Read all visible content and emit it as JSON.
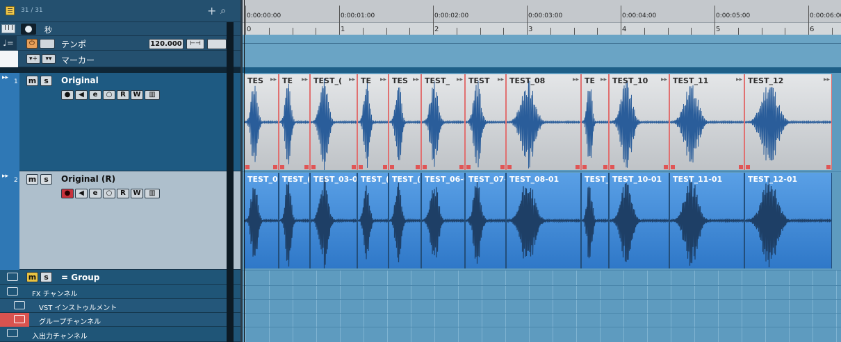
{
  "header": {
    "track_count": "31 / 31",
    "add": "+",
    "search": "⌕"
  },
  "ruler_tracks": {
    "time_unit": "秒",
    "tempo": {
      "label": "テンポ",
      "value": "120.000"
    },
    "marker": {
      "label": "マーカー"
    }
  },
  "tracks": [
    {
      "number": "1",
      "name": "Original",
      "m": "m",
      "s": "s",
      "r": "R",
      "w": "W",
      "e": "e"
    },
    {
      "number": "2",
      "name": "Original (R)",
      "m": "m",
      "s": "s",
      "r": "R",
      "w": "W",
      "e": "e"
    }
  ],
  "folders": [
    {
      "name": "= Group",
      "m": "m",
      "s": "s"
    },
    {
      "name": "FX チャンネル"
    },
    {
      "name": "VST インストゥルメント"
    },
    {
      "name": "グループチャンネル"
    },
    {
      "name": "入出力チャンネル"
    }
  ],
  "timeline": {
    "bars": [
      "0",
      "1",
      "2",
      "3",
      "4",
      "5",
      "6"
    ],
    "times": [
      "0:00:00:00",
      "0:00:01:00",
      "0:00:02:00",
      "0:00:03:00",
      "0:00:04:00",
      "0:00:05:00",
      "0:00:06:00"
    ]
  },
  "clips_track1": [
    "TES",
    "TE",
    "TEST_(",
    "TE",
    "TES",
    "TEST_",
    "TEST",
    "TEST_08",
    "TE",
    "TEST_10",
    "TEST_11",
    "TEST_12"
  ],
  "clips_track2": [
    "TEST_0",
    "TEST_(",
    "TEST_03-0",
    "TEST_(",
    "TEST_(",
    "TEST_06-0",
    "TEST_07-",
    "TEST_08-01",
    "TEST_",
    "TEST_10-01",
    "TEST_11-01",
    "TEST_12-01"
  ],
  "colors": {
    "accent_blue": "#2f78b5",
    "clip_gray": "#cfd2d5",
    "clip_blue": "#4a90d9",
    "record_red": "#c8323c",
    "folder_highlight": "#d9534f",
    "group_yellow": "#e9c341"
  }
}
